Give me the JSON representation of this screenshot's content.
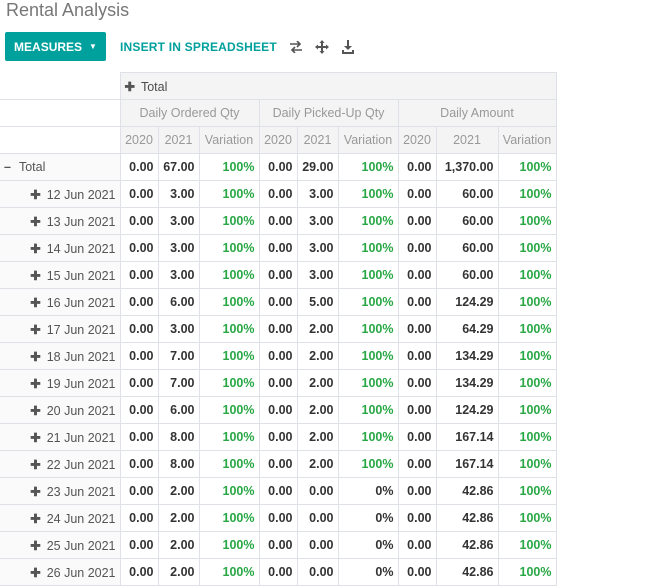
{
  "page": {
    "title": "Rental Analysis"
  },
  "toolbar": {
    "measures_label": "MEASURES",
    "insert_label": "INSERT IN SPREADSHEET"
  },
  "pivot": {
    "col_total_label": "Total",
    "measures": [
      "Daily Ordered Qty",
      "Daily Picked-Up Qty",
      "Daily Amount"
    ],
    "subheaders": [
      "2020",
      "2021",
      "Variation",
      "2020",
      "2021",
      "Variation",
      "2020",
      "2021",
      "Variation"
    ],
    "rows": [
      {
        "label": "Total",
        "total": true,
        "cells": [
          "0.00",
          "67.00",
          "100%",
          "0.00",
          "29.00",
          "100%",
          "0.00",
          "1,370.00",
          "100%"
        ]
      },
      {
        "label": "12 Jun 2021",
        "cells": [
          "0.00",
          "3.00",
          "100%",
          "0.00",
          "3.00",
          "100%",
          "0.00",
          "60.00",
          "100%"
        ]
      },
      {
        "label": "13 Jun 2021",
        "cells": [
          "0.00",
          "3.00",
          "100%",
          "0.00",
          "3.00",
          "100%",
          "0.00",
          "60.00",
          "100%"
        ]
      },
      {
        "label": "14 Jun 2021",
        "cells": [
          "0.00",
          "3.00",
          "100%",
          "0.00",
          "3.00",
          "100%",
          "0.00",
          "60.00",
          "100%"
        ]
      },
      {
        "label": "15 Jun 2021",
        "cells": [
          "0.00",
          "3.00",
          "100%",
          "0.00",
          "3.00",
          "100%",
          "0.00",
          "60.00",
          "100%"
        ]
      },
      {
        "label": "16 Jun 2021",
        "cells": [
          "0.00",
          "6.00",
          "100%",
          "0.00",
          "5.00",
          "100%",
          "0.00",
          "124.29",
          "100%"
        ]
      },
      {
        "label": "17 Jun 2021",
        "cells": [
          "0.00",
          "3.00",
          "100%",
          "0.00",
          "2.00",
          "100%",
          "0.00",
          "64.29",
          "100%"
        ]
      },
      {
        "label": "18 Jun 2021",
        "cells": [
          "0.00",
          "7.00",
          "100%",
          "0.00",
          "2.00",
          "100%",
          "0.00",
          "134.29",
          "100%"
        ]
      },
      {
        "label": "19 Jun 2021",
        "cells": [
          "0.00",
          "7.00",
          "100%",
          "0.00",
          "2.00",
          "100%",
          "0.00",
          "134.29",
          "100%"
        ]
      },
      {
        "label": "20 Jun 2021",
        "cells": [
          "0.00",
          "6.00",
          "100%",
          "0.00",
          "2.00",
          "100%",
          "0.00",
          "124.29",
          "100%"
        ]
      },
      {
        "label": "21 Jun 2021",
        "cells": [
          "0.00",
          "8.00",
          "100%",
          "0.00",
          "2.00",
          "100%",
          "0.00",
          "167.14",
          "100%"
        ]
      },
      {
        "label": "22 Jun 2021",
        "cells": [
          "0.00",
          "8.00",
          "100%",
          "0.00",
          "2.00",
          "100%",
          "0.00",
          "167.14",
          "100%"
        ]
      },
      {
        "label": "23 Jun 2021",
        "cells": [
          "0.00",
          "2.00",
          "100%",
          "0.00",
          "0.00",
          "0%",
          "0.00",
          "42.86",
          "100%"
        ]
      },
      {
        "label": "24 Jun 2021",
        "cells": [
          "0.00",
          "2.00",
          "100%",
          "0.00",
          "0.00",
          "0%",
          "0.00",
          "42.86",
          "100%"
        ]
      },
      {
        "label": "25 Jun 2021",
        "cells": [
          "0.00",
          "2.00",
          "100%",
          "0.00",
          "0.00",
          "0%",
          "0.00",
          "42.86",
          "100%"
        ]
      },
      {
        "label": "26 Jun 2021",
        "cells": [
          "0.00",
          "2.00",
          "100%",
          "0.00",
          "0.00",
          "0%",
          "0.00",
          "42.86",
          "100%"
        ]
      }
    ]
  }
}
